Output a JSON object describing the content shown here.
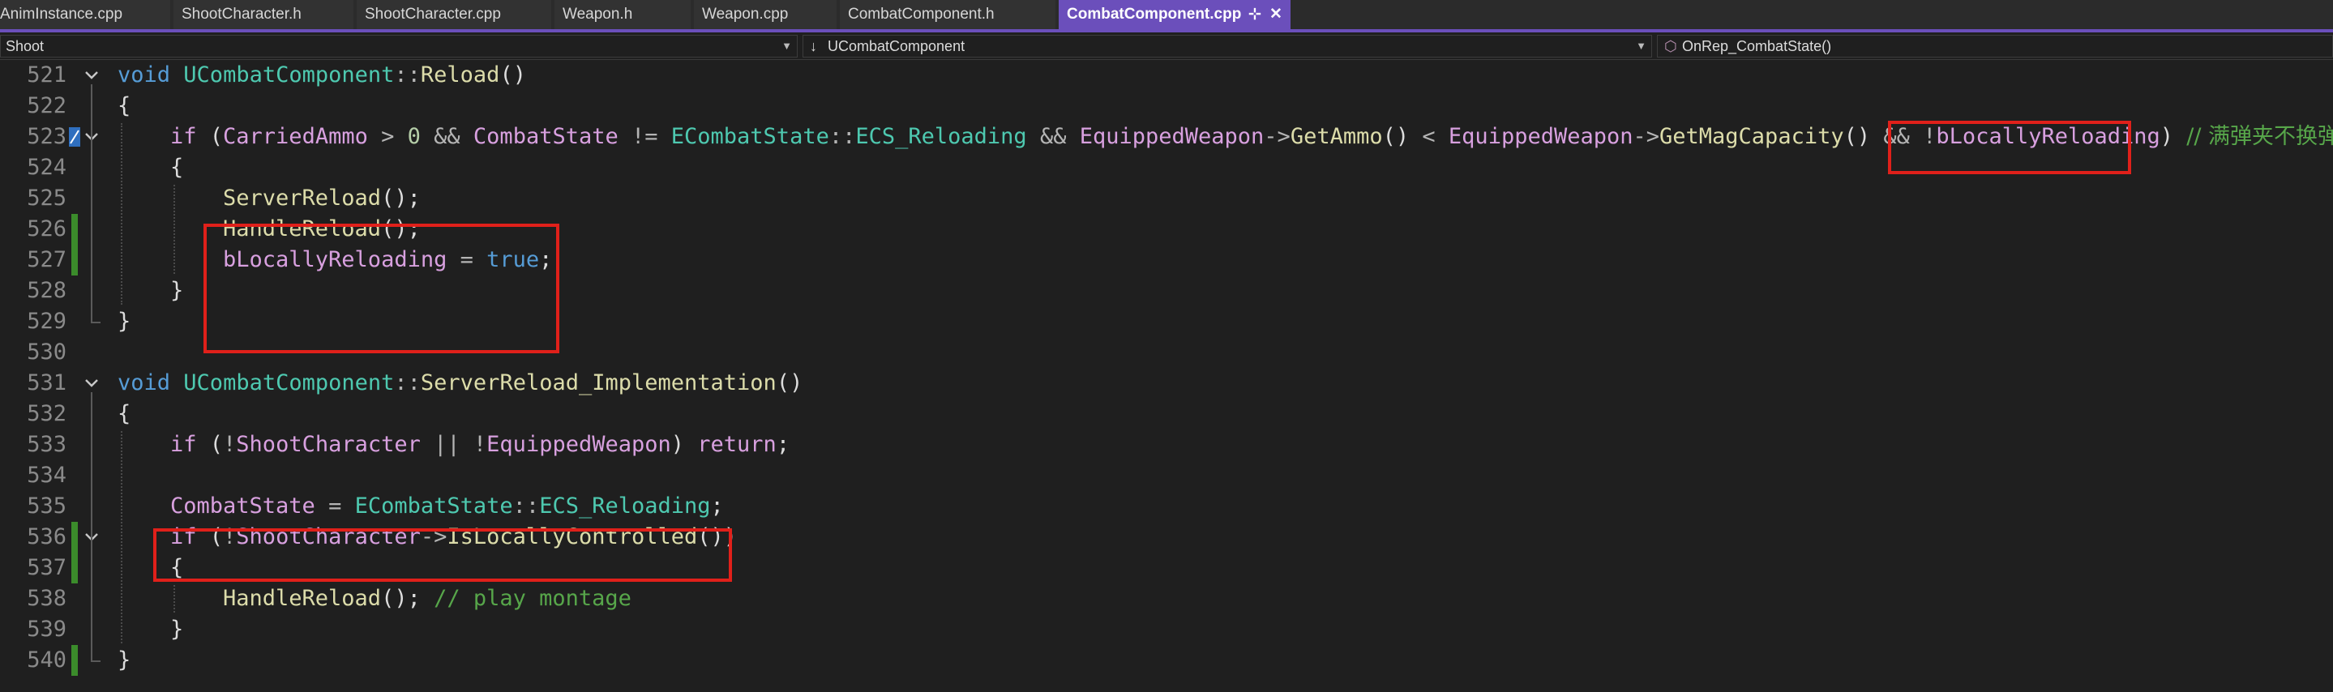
{
  "tabs": [
    {
      "label": "AnimInstance.cpp",
      "active": false
    },
    {
      "label": "ShootCharacter.h",
      "active": false
    },
    {
      "label": "ShootCharacter.cpp",
      "active": false
    },
    {
      "label": "Weapon.h",
      "active": false
    },
    {
      "label": "Weapon.cpp",
      "active": false
    },
    {
      "label": "CombatComponent.h",
      "active": false
    },
    {
      "label": "CombatComponent.cpp",
      "active": true
    }
  ],
  "tab_pin_glyph": "⊹",
  "tab_close_glyph": "✕",
  "navbar": {
    "project": "Shoot",
    "scope": "UCombatComponent",
    "member": "OnRep_CombatState()"
  },
  "icons": {
    "dropdown": "chevron-down-icon",
    "scope": "arrow-down-icon",
    "member": "cube-icon"
  },
  "colors": {
    "accent_tab": "#6b4fbb",
    "highlight_box": "#e0201a",
    "change_bar": "#3b8c2b",
    "keyword": "#569cd6",
    "control": "#d8a0df",
    "type": "#4ec9b0",
    "function": "#dcdcaa",
    "comment": "#57a64a"
  },
  "editor": {
    "lines": [
      {
        "n": "521",
        "indent": 0,
        "fold": true,
        "changed": false,
        "tokens": [
          {
            "t": "void",
            "c": "kw"
          },
          {
            "t": " "
          },
          {
            "t": "UCombatComponent",
            "c": "cls"
          },
          {
            "t": "::",
            "c": "op"
          },
          {
            "t": "Reload",
            "c": "fn"
          },
          {
            "t": "()"
          }
        ]
      },
      {
        "n": "522",
        "indent": 0,
        "tokens": [
          {
            "t": "{"
          }
        ]
      },
      {
        "n": "523",
        "indent": 1,
        "fold": true,
        "changed": false,
        "marker": true,
        "tokens": [
          {
            "t": "if",
            "c": "ctl"
          },
          {
            "t": " ("
          },
          {
            "t": "CarriedAmmo",
            "c": "ctl"
          },
          {
            "t": " > ",
            "c": "op"
          },
          {
            "t": "0",
            "c": "num"
          },
          {
            "t": " && ",
            "c": "op"
          },
          {
            "t": "CombatState",
            "c": "ctl"
          },
          {
            "t": " != ",
            "c": "op"
          },
          {
            "t": "ECombatState",
            "c": "cls"
          },
          {
            "t": "::",
            "c": "op"
          },
          {
            "t": "ECS_Reloading",
            "c": "cls"
          },
          {
            "t": " && ",
            "c": "op"
          },
          {
            "t": "EquippedWeapon",
            "c": "ctl"
          },
          {
            "t": "->",
            "c": "op"
          },
          {
            "t": "GetAmmo",
            "c": "fn"
          },
          {
            "t": "() "
          },
          {
            "t": "<",
            "c": "op"
          },
          {
            "t": " "
          },
          {
            "t": "EquippedWeapon",
            "c": "ctl"
          },
          {
            "t": "->",
            "c": "op"
          },
          {
            "t": "GetMagCapacity",
            "c": "fn"
          },
          {
            "t": "() "
          },
          {
            "t": "&&",
            "c": "op"
          },
          {
            "t": " "
          },
          {
            "t": "!",
            "c": "op"
          },
          {
            "t": "bLocallyReloading",
            "c": "ctl"
          },
          {
            "t": ") "
          },
          {
            "t": "// 满弹夹不换弹",
            "c": "cmt"
          }
        ]
      },
      {
        "n": "524",
        "indent": 1,
        "tokens": [
          {
            "t": "{"
          }
        ]
      },
      {
        "n": "525",
        "indent": 2,
        "tokens": [
          {
            "t": "ServerReload",
            "c": "fn"
          },
          {
            "t": "();"
          }
        ]
      },
      {
        "n": "526",
        "indent": 2,
        "changed": true,
        "tokens": [
          {
            "t": "HandleReload",
            "c": "fn"
          },
          {
            "t": "();"
          }
        ]
      },
      {
        "n": "527",
        "indent": 2,
        "changed": true,
        "tokens": [
          {
            "t": "bLocallyReloading",
            "c": "ctl"
          },
          {
            "t": " = ",
            "c": "op"
          },
          {
            "t": "true",
            "c": "kw"
          },
          {
            "t": ";"
          }
        ]
      },
      {
        "n": "528",
        "indent": 1,
        "tokens": [
          {
            "t": "}"
          }
        ]
      },
      {
        "n": "529",
        "indent": 0,
        "tokens": [
          {
            "t": "}"
          }
        ]
      },
      {
        "n": "530",
        "indent": 0,
        "tokens": []
      },
      {
        "n": "531",
        "indent": 0,
        "fold": true,
        "tokens": [
          {
            "t": "void",
            "c": "kw"
          },
          {
            "t": " "
          },
          {
            "t": "UCombatComponent",
            "c": "cls"
          },
          {
            "t": "::",
            "c": "op"
          },
          {
            "t": "ServerReload_Implementation",
            "c": "fn"
          },
          {
            "t": "()"
          }
        ]
      },
      {
        "n": "532",
        "indent": 0,
        "tokens": [
          {
            "t": "{"
          }
        ]
      },
      {
        "n": "533",
        "indent": 1,
        "tokens": [
          {
            "t": "if",
            "c": "ctl"
          },
          {
            "t": " ("
          },
          {
            "t": "!",
            "c": "op"
          },
          {
            "t": "ShootCharacter",
            "c": "ctl"
          },
          {
            "t": " || ",
            "c": "op"
          },
          {
            "t": "!",
            "c": "op"
          },
          {
            "t": "EquippedWeapon",
            "c": "ctl"
          },
          {
            "t": ") "
          },
          {
            "t": "return",
            "c": "ctl"
          },
          {
            "t": ";"
          }
        ]
      },
      {
        "n": "534",
        "indent": 0,
        "tokens": []
      },
      {
        "n": "535",
        "indent": 1,
        "tokens": [
          {
            "t": "CombatState",
            "c": "ctl"
          },
          {
            "t": " = ",
            "c": "op"
          },
          {
            "t": "ECombatState",
            "c": "cls"
          },
          {
            "t": "::",
            "c": "op"
          },
          {
            "t": "ECS_Reloading",
            "c": "cls"
          },
          {
            "t": ";"
          }
        ]
      },
      {
        "n": "536",
        "indent": 1,
        "fold": true,
        "changed": true,
        "tokens": [
          {
            "t": "if",
            "c": "ctl"
          },
          {
            "t": " ("
          },
          {
            "t": "!",
            "c": "op"
          },
          {
            "t": "ShootCharacter",
            "c": "ctl"
          },
          {
            "t": "->",
            "c": "op"
          },
          {
            "t": "IsLocallyControlled",
            "c": "fn"
          },
          {
            "t": "())"
          }
        ]
      },
      {
        "n": "537",
        "indent": 1,
        "changed": true,
        "tokens": [
          {
            "t": "{"
          }
        ]
      },
      {
        "n": "538",
        "indent": 2,
        "tokens": [
          {
            "t": "HandleReload",
            "c": "fn"
          },
          {
            "t": "(); "
          },
          {
            "t": "// play montage",
            "c": "cmt"
          }
        ]
      },
      {
        "n": "539",
        "indent": 1,
        "tokens": [
          {
            "t": "}"
          }
        ]
      },
      {
        "n": "540",
        "indent": 0,
        "changed": true,
        "tokens": [
          {
            "t": "}"
          }
        ]
      }
    ]
  }
}
